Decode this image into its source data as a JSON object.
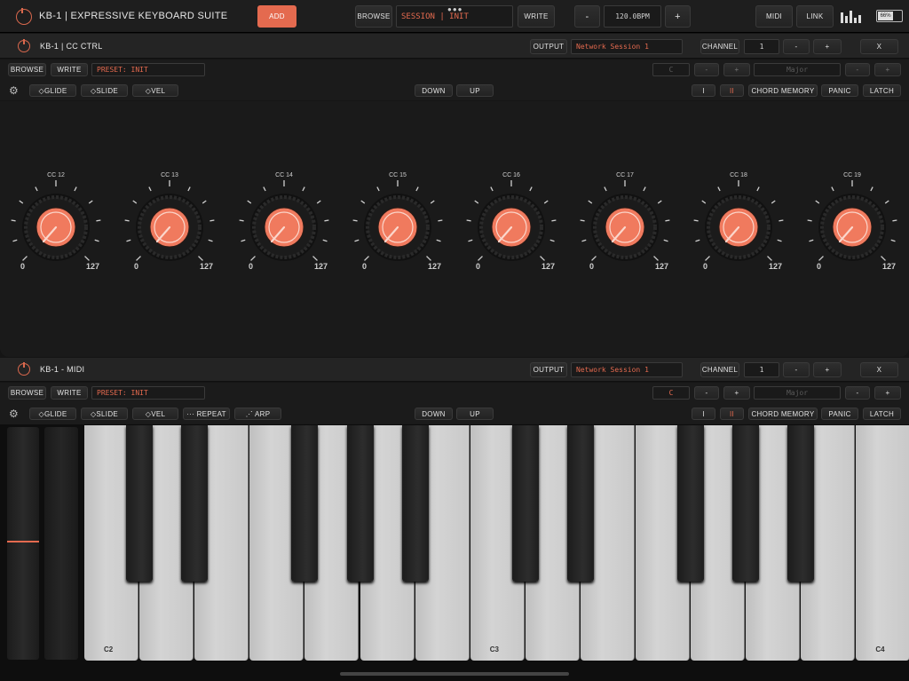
{
  "app": {
    "title": "KB-1 | EXPRESSIVE KEYBOARD SUITE",
    "add_label": "ADD",
    "browse_label": "BROWSE",
    "session_value": "SESSION | INIT",
    "write_label": "WRITE",
    "minus_label": "-",
    "tempo_value": "120.0BPM",
    "plus_label": "+",
    "midi_label": "MIDI",
    "link_label": "LINK",
    "battery_text": "66%"
  },
  "panels": {
    "cc": {
      "title": "KB-1 | CC CTRL",
      "output_label": "OUTPUT",
      "output_value": "Network Session 1",
      "channel_label": "CHANNEL",
      "channel_value": "1",
      "minus_label": "-",
      "plus_label": "+",
      "close_label": "X",
      "browse_label": "BROWSE",
      "write_label": "WRITE",
      "preset_value": "PRESET: INIT",
      "key_value": "C",
      "scale_value": "Major",
      "glide_label": "◇GLIDE",
      "slide_label": "◇SLIDE",
      "vel_label": "◇VEL",
      "down_label": "DOWN",
      "up_label": "UP",
      "i_label": "I",
      "ii_label": "II",
      "chord_label": "CHORD MEMORY",
      "panic_label": "PANIC",
      "latch_label": "LATCH"
    },
    "midi": {
      "title": "KB-1 - MIDI",
      "output_label": "OUTPUT",
      "output_value": "Network Session 1",
      "channel_label": "CHANNEL",
      "channel_value": "1",
      "minus_label": "-",
      "plus_label": "+",
      "close_label": "X",
      "browse_label": "BROWSE",
      "write_label": "WRITE",
      "preset_value": "PRESET: INIT",
      "key_value": "C",
      "scale_value": "Major",
      "glide_label": "◇GLIDE",
      "slide_label": "◇SLIDE",
      "vel_label": "◇VEL",
      "repeat_label": "··· REPEAT",
      "arp_label": "⋰ ARP",
      "down_label": "DOWN",
      "up_label": "UP",
      "i_label": "I",
      "ii_label": "II",
      "chord_label": "CHORD MEMORY",
      "panic_label": "PANIC",
      "latch_label": "LATCH"
    }
  },
  "knobs": [
    {
      "label": "CC 12",
      "min": "0",
      "max": "127"
    },
    {
      "label": "CC 13",
      "min": "0",
      "max": "127"
    },
    {
      "label": "CC 14",
      "min": "0",
      "max": "127"
    },
    {
      "label": "CC 15",
      "min": "0",
      "max": "127"
    },
    {
      "label": "CC 16",
      "min": "0",
      "max": "127"
    },
    {
      "label": "CC 17",
      "min": "0",
      "max": "127"
    },
    {
      "label": "CC 18",
      "min": "0",
      "max": "127"
    },
    {
      "label": "CC 19",
      "min": "0",
      "max": "127"
    }
  ],
  "keyboard": {
    "labels": [
      "C2",
      "C3",
      "C4"
    ]
  },
  "colors": {
    "accent": "#e46a4f",
    "knob": "#f07a5e",
    "background": "#151515"
  }
}
